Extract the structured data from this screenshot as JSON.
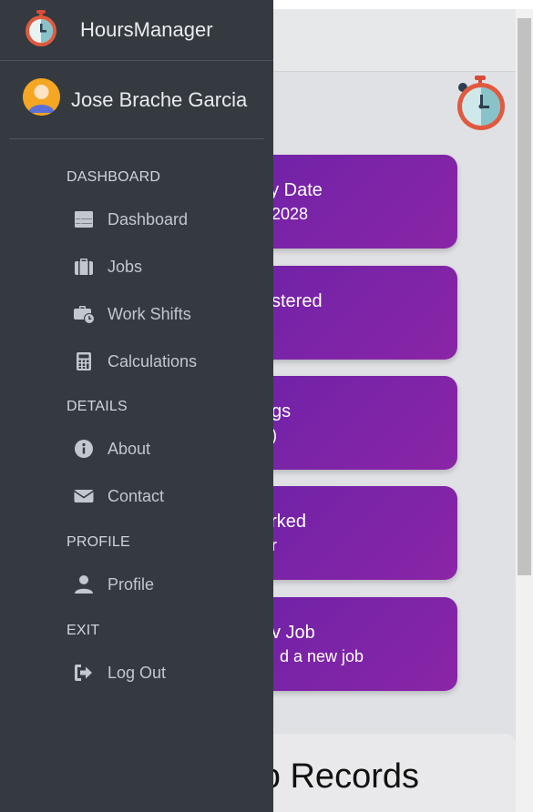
{
  "app": {
    "title": "HoursManager"
  },
  "user": {
    "name": "Jose Brache Garcia"
  },
  "sidebar": {
    "sections": [
      {
        "label": "DASHBOARD"
      },
      {
        "label": "DETAILS"
      },
      {
        "label": "PROFILE"
      },
      {
        "label": "EXIT"
      }
    ],
    "items": [
      {
        "label": "Dashboard",
        "icon": "table-icon"
      },
      {
        "label": "Jobs",
        "icon": "suitcase-icon"
      },
      {
        "label": "Work Shifts",
        "icon": "business-time-icon"
      },
      {
        "label": "Calculations",
        "icon": "calculator-icon"
      },
      {
        "label": "About",
        "icon": "info-circle-icon"
      },
      {
        "label": "Contact",
        "icon": "envelope-icon"
      },
      {
        "label": "Profile",
        "icon": "user-icon"
      },
      {
        "label": "Log Out",
        "icon": "sign-out-icon"
      }
    ]
  },
  "main": {
    "cards": [
      {
        "title": "ay Date",
        "sub": "2028"
      },
      {
        "title": "stered",
        "sub": ""
      },
      {
        "title": "gs",
        "sub": ")"
      },
      {
        "title": "orked",
        "sub": "r"
      },
      {
        "title": "v Job",
        "sub": "d a new job"
      }
    ],
    "records_title": "o Records"
  },
  "colors": {
    "sidebar_bg": "#343a40",
    "card_purple": "#7a23a8",
    "page_bg": "#e0e1e5"
  }
}
